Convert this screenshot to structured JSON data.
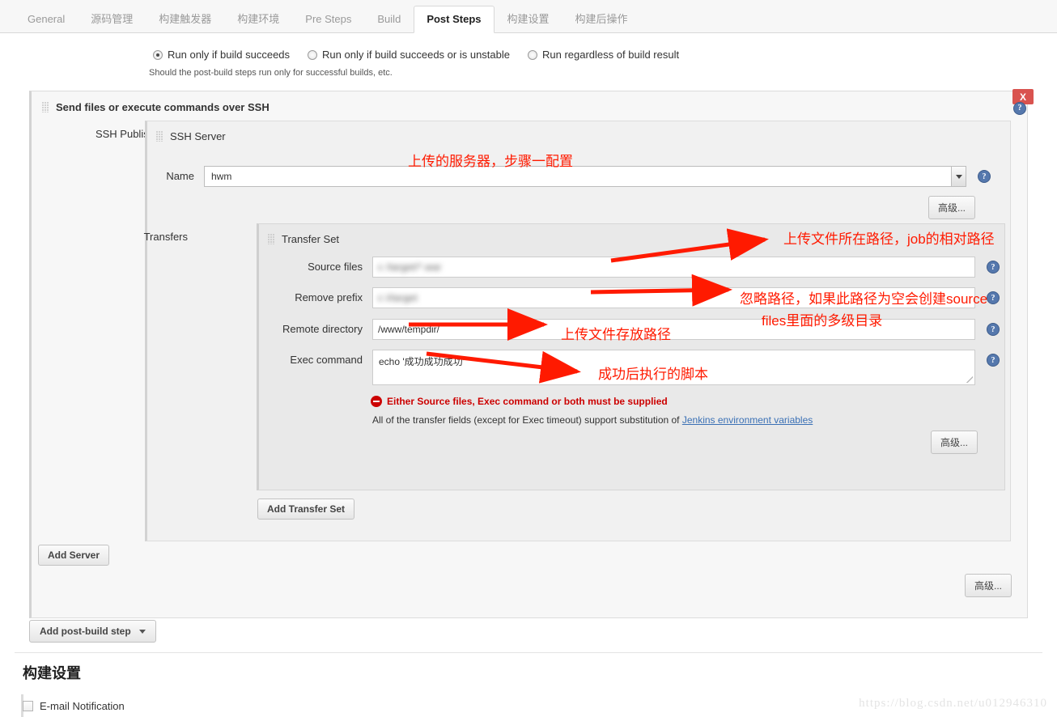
{
  "tabs": [
    {
      "label": "General",
      "active": false
    },
    {
      "label": "源码管理",
      "active": false
    },
    {
      "label": "构建触发器",
      "active": false
    },
    {
      "label": "构建环境",
      "active": false
    },
    {
      "label": "Pre Steps",
      "active": false
    },
    {
      "label": "Build",
      "active": false
    },
    {
      "label": "Post Steps",
      "active": true
    },
    {
      "label": "构建设置",
      "active": false
    },
    {
      "label": "构建后操作",
      "active": false
    }
  ],
  "run_conditions": {
    "options": [
      {
        "label": "Run only if build succeeds",
        "checked": true
      },
      {
        "label": "Run only if build succeeds or is unstable",
        "checked": false
      },
      {
        "label": "Run regardless of build result",
        "checked": false
      }
    ],
    "help_text": "Should the post-build steps run only for successful builds, etc."
  },
  "ssh_block": {
    "title": "Send files or execute commands over SSH",
    "close_label": "X",
    "publishers_label": "SSH Publishers",
    "server": {
      "title": "SSH Server",
      "name_label": "Name",
      "name_value": "hwm",
      "advanced_label": "高级..."
    },
    "transfers_label": "Transfers",
    "transfer_set": {
      "title": "Transfer Set",
      "fields": [
        {
          "label": "Source files",
          "value": "c                                                 /target/*.war",
          "blurred": true
        },
        {
          "label": "Remove prefix",
          "value": "c                                                 i/target",
          "blurred": true
        },
        {
          "label": "Remote directory",
          "value": "/www/tempdir/",
          "blurred": false
        },
        {
          "label": "Exec command",
          "value": "echo '成功成功成功'",
          "blurred": false
        }
      ],
      "error": "Either Source files, Exec command or both must be supplied",
      "hint_prefix": "All of the transfer fields (except for Exec timeout) support substitution of ",
      "hint_link": "Jenkins environment variables",
      "advanced_label": "高级..."
    },
    "add_transfer_set_label": "Add Transfer Set",
    "add_server_label": "Add Server",
    "advanced_label": "高级..."
  },
  "add_post_build_step_label": "Add post-build step",
  "build_settings": {
    "title": "构建设置",
    "email_notification_label": "E-mail Notification"
  },
  "annotations": [
    {
      "id": "server-note",
      "text": "上传的服务器，步骤一配置"
    },
    {
      "id": "source-files-note",
      "text": "上传文件所在路径，job的相对路径"
    },
    {
      "id": "remove-prefix-note-1",
      "text": "忽略路径，如果此路径为空会创建source"
    },
    {
      "id": "remove-prefix-note-2",
      "text": "files里面的多级目录"
    },
    {
      "id": "remote-dir-note",
      "text": "上传文件存放路径"
    },
    {
      "id": "exec-command-note",
      "text": "成功后执行的脚本"
    }
  ],
  "watermark": "https://blog.csdn.net/u012946310",
  "colors": {
    "annotation_red": "#ff1a00",
    "error_red": "#cc0000",
    "link_blue": "#3a70b5",
    "close_red": "#d9534f"
  }
}
